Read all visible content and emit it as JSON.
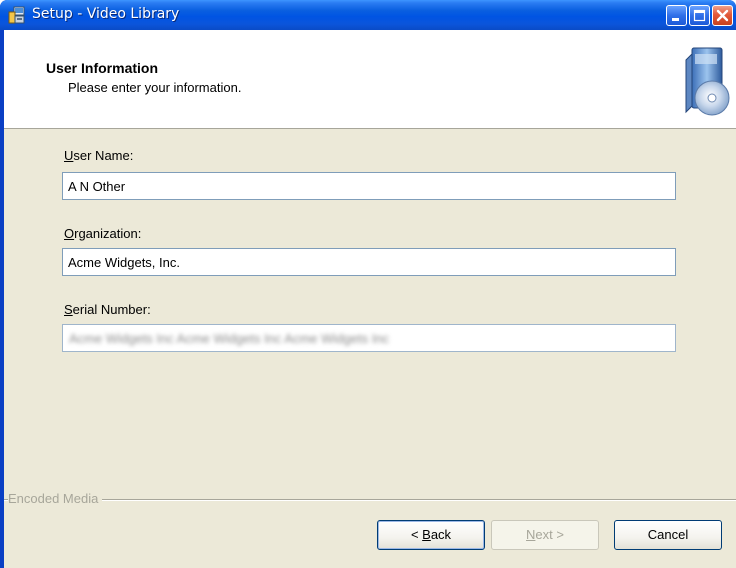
{
  "window": {
    "title": "Setup - Video Library"
  },
  "header": {
    "title": "User Information",
    "subtitle": "Please enter your information."
  },
  "form": {
    "user_name": {
      "label_accel": "U",
      "label_rest": "ser Name:",
      "value": "A N Other"
    },
    "organization": {
      "label_accel": "O",
      "label_rest": "rganization:",
      "value": "Acme Widgets, Inc."
    },
    "serial_number": {
      "label_accel": "S",
      "label_rest": "erial Number:",
      "value": "Acme Widgets Inc Acme Widgets Inc Acme Widgets Inc"
    }
  },
  "footer": {
    "group_label": "Encoded Media",
    "back": {
      "prefix": "< ",
      "accel": "B",
      "rest": "ack"
    },
    "next": {
      "prefix": "",
      "accel": "N",
      "rest": "ext >"
    },
    "cancel": "Cancel"
  },
  "colors": {
    "titlebar": "#0054e3",
    "client_bg": "#ece9d8",
    "input_border": "#7f9db9",
    "disabled_text": "#a7a69a"
  },
  "icons": {
    "app": "setup-icon",
    "header_graphic": "cd-box-icon",
    "minimize": "minimize-icon",
    "maximize": "maximize-icon",
    "close": "close-icon"
  }
}
